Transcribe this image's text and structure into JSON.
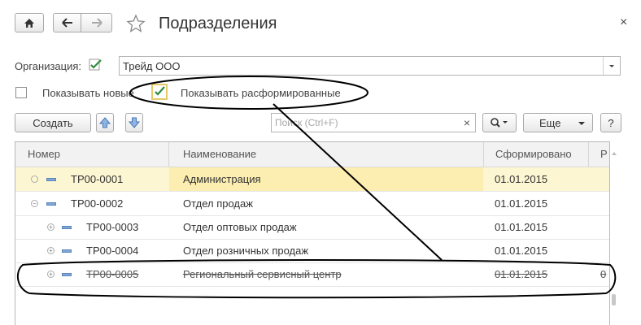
{
  "header": {
    "title": "Подразделения",
    "close_glyph": "×"
  },
  "nav": {
    "home_icon": "home-icon",
    "back_icon": "arrow-left-icon",
    "forward_icon": "arrow-right-icon",
    "favorite_icon": "star-icon"
  },
  "filters": {
    "organization_label": "Организация:",
    "organization_value": "Трейд ООО",
    "show_new_label": "Показывать новые",
    "show_disbanded_label": "Показывать расформированные"
  },
  "toolbar": {
    "create_label": "Создать",
    "search_placeholder": "Поиск (Ctrl+F)",
    "clear_glyph": "×",
    "more_label": "Еще",
    "help_label": "?"
  },
  "table": {
    "columns": [
      "Номер",
      "Наименование",
      "Сформировано",
      "Р"
    ],
    "rows": [
      {
        "number": "ТР00-0001",
        "name": "Администрация",
        "date": "01.01.2015",
        "extra": "",
        "level": 0,
        "selected": true,
        "disbanded": false
      },
      {
        "number": "ТР00-0002",
        "name": "Отдел продаж",
        "date": "01.01.2015",
        "extra": "",
        "level": 0,
        "selected": false,
        "disbanded": false
      },
      {
        "number": "ТР00-0003",
        "name": "Отдел оптовых продаж",
        "date": "01.01.2015",
        "extra": "",
        "level": 1,
        "selected": false,
        "disbanded": false
      },
      {
        "number": "ТР00-0004",
        "name": "Отдел розничных продаж",
        "date": "01.01.2015",
        "extra": "",
        "level": 1,
        "selected": false,
        "disbanded": false
      },
      {
        "number": "ТР00-0005",
        "name": "Региональный сервисный центр",
        "date": "01.01.2015",
        "extra": "0",
        "level": 1,
        "selected": false,
        "disbanded": true
      }
    ]
  },
  "colors": {
    "selected_row": "#fbeeb0",
    "checkbox_mark": "#2e8b3a",
    "accent_blue": "#5b84bb"
  }
}
